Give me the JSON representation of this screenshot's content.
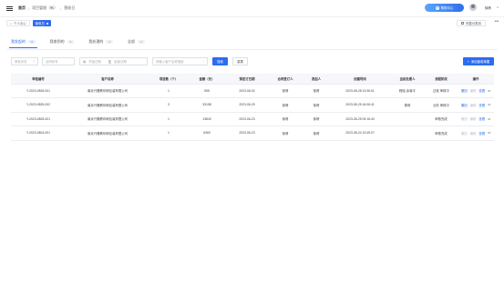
{
  "header": {
    "breadcrumbs": [
      "首页",
      "项目管理（新）",
      "营收日"
    ],
    "help_label": "帮助中心",
    "username": "徐倩"
  },
  "tagbar": {
    "home_tag": "个人中心",
    "active_tag": "营收日",
    "right_label": "完整分类页"
  },
  "tabs": [
    {
      "label": "我发起的",
      "count": "4"
    },
    {
      "label": "我收到的",
      "count": "0"
    },
    {
      "label": "我处理的",
      "count": "4"
    },
    {
      "label": "全部",
      "count": "4"
    }
  ],
  "filters": {
    "status_placeholder": "审批状态",
    "keyword_placeholder": "合同标号",
    "start_placeholder": "开始日期",
    "range_sep": "至",
    "end_placeholder": "结束日期",
    "customer_placeholder": "请输入客户名称搜索",
    "search_label": "搜索",
    "reset_label": "重置",
    "add_label": "添加营收单据"
  },
  "table": {
    "headers": [
      "审批编号",
      "客户名称",
      "项目数（个）",
      "金额（元）",
      "预定订日期",
      "合同签订人",
      "发起人",
      "创建时间",
      "当前处理人",
      "流程阶段",
      "操作"
    ],
    "rows": [
      {
        "id": "Y-2023-0826-001",
        "customer": "南京兴隆教印刷包装有限公司",
        "projects": "1",
        "amount": "555",
        "date": "2023-06-02",
        "signer": "徐倩",
        "initiator": "徐倩",
        "created": "2023-08-28 13:36:01",
        "handler": "程晓,余菊平",
        "stage": "过帐 审核中",
        "stage_type": "a",
        "ops": [
          {
            "t": "撤回",
            "on": true
          },
          {
            "t": "编辑",
            "on": false
          },
          {
            "t": "查看",
            "on": true
          }
        ]
      },
      {
        "id": "Y-2023-0825-002",
        "customer": "南京兴隆教印刷包装有限公司",
        "projects": "3",
        "amount": "33158",
        "date": "2023-06-29",
        "signer": "徐倩",
        "initiator": "徐倩",
        "created": "2023-08-25 16:06:41",
        "handler": "周莉",
        "stage": "业务 审核中",
        "stage_type": "a",
        "ops": [
          {
            "t": "撤回",
            "on": true
          },
          {
            "t": "编辑",
            "on": false
          },
          {
            "t": "查看",
            "on": true
          }
        ]
      },
      {
        "id": "Y-2023-0825-001",
        "customer": "南京兴隆教印刷包装有限公司",
        "projects": "1",
        "amount": "13840",
        "date": "2023-06-23",
        "signer": "徐倩",
        "initiator": "徐倩",
        "created": "2023-08-25 09:16:40",
        "handler": "",
        "stage": "审核完成",
        "stage_type": "b",
        "ops": [
          {
            "t": "撤回",
            "on": false
          },
          {
            "t": "编辑",
            "on": false
          },
          {
            "t": "查看",
            "on": true
          }
        ]
      },
      {
        "id": "Y-2023-0824-001",
        "customer": "南京兴隆教印刷包装有限公司",
        "projects": "1",
        "amount": "6360",
        "date": "2023-06-23",
        "signer": "徐倩",
        "initiator": "徐倩",
        "created": "2023-08-24 13:45:07",
        "handler": "",
        "stage": "审核完成",
        "stage_type": "b",
        "ops": [
          {
            "t": "撤回",
            "on": false
          },
          {
            "t": "编辑",
            "on": false
          },
          {
            "t": "查看",
            "on": true
          }
        ]
      }
    ]
  },
  "colors": {
    "accent": "#2d6cf0",
    "success": "#1fae5c"
  }
}
